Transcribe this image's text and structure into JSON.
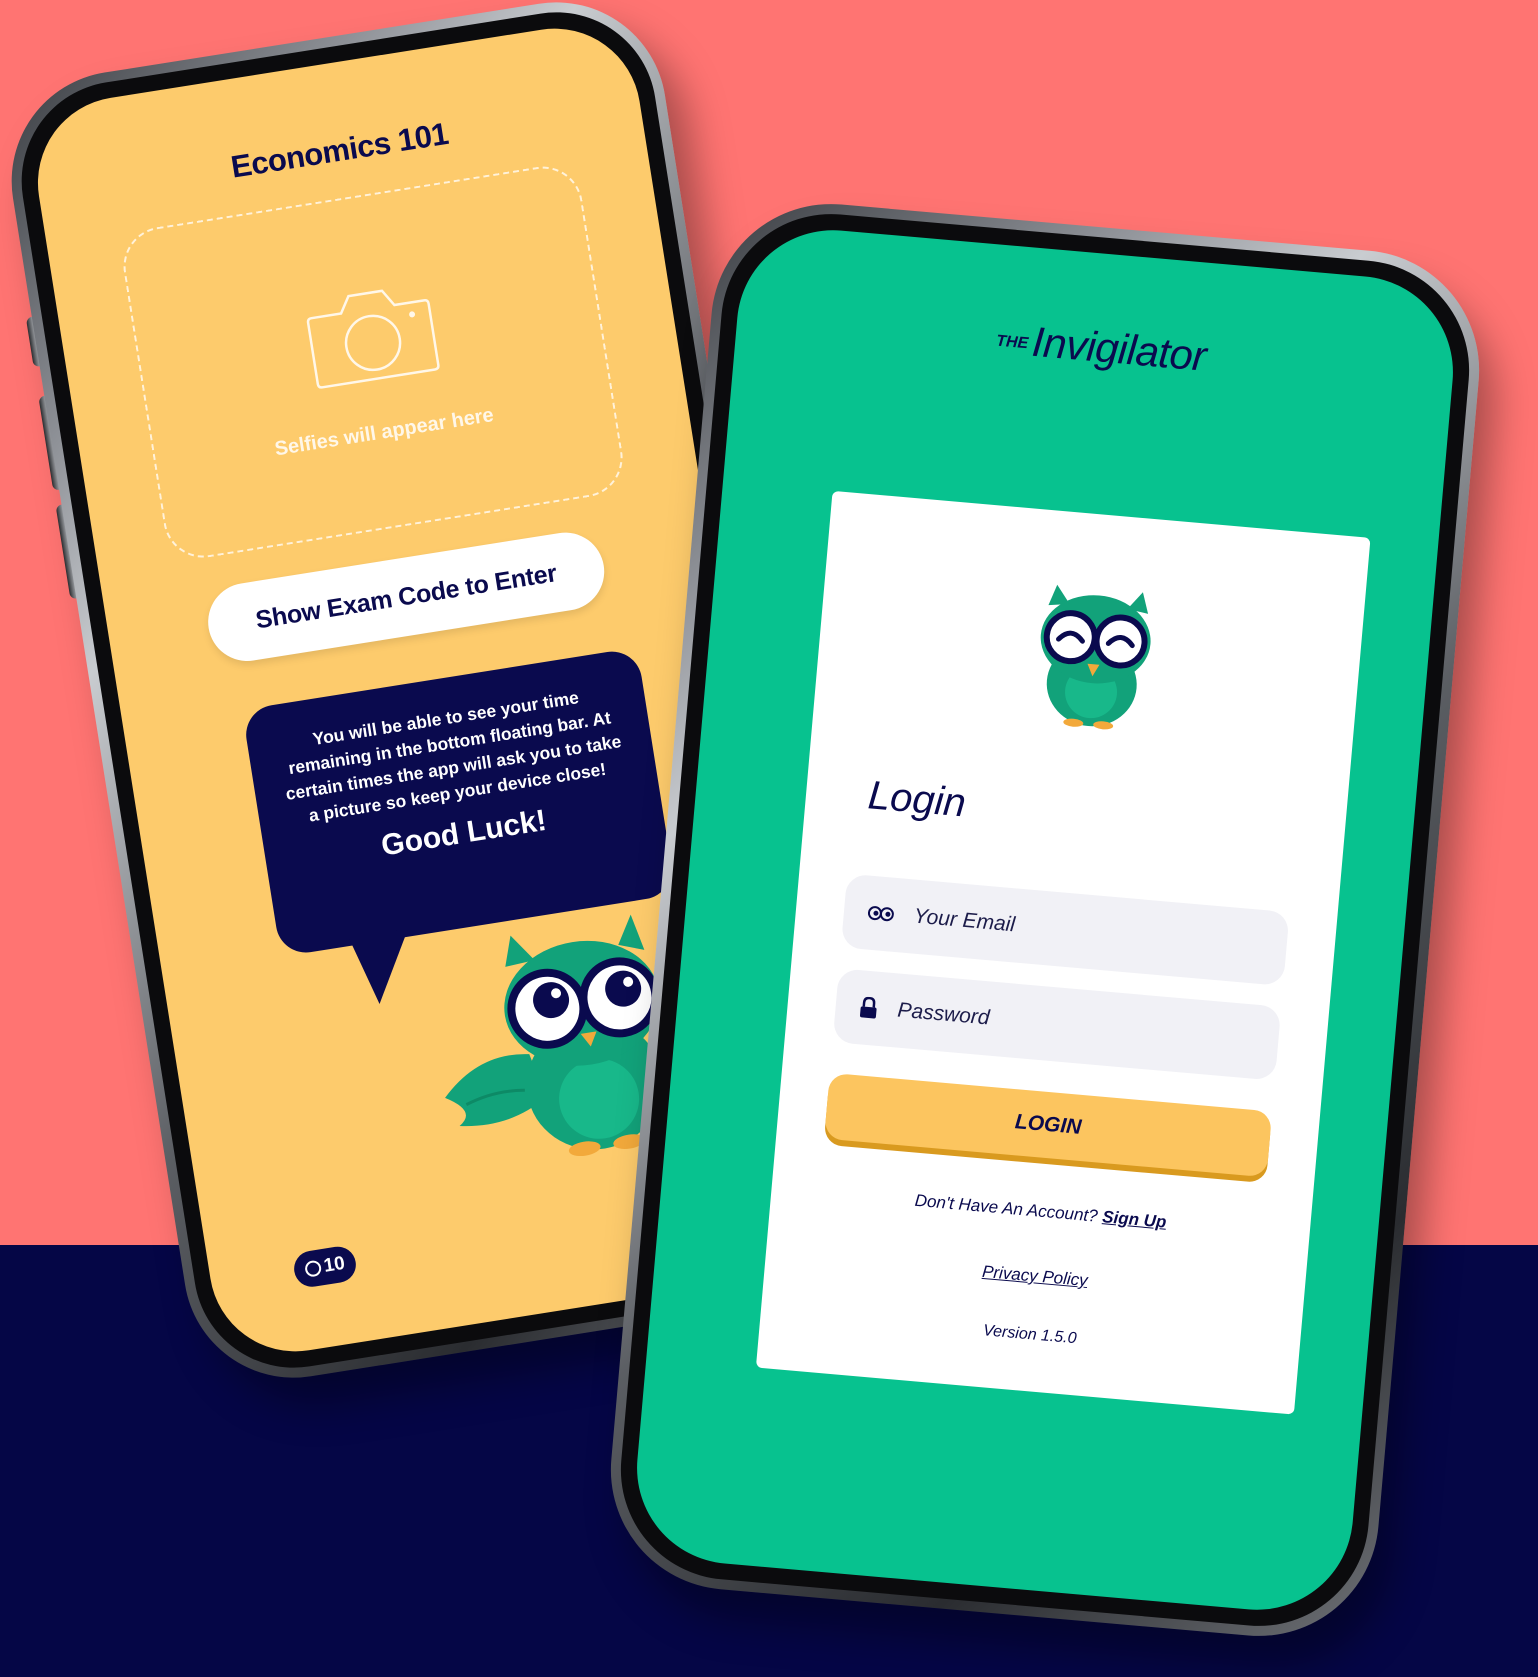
{
  "colors": {
    "background_top": "#ff7472",
    "background_bottom": "#050646",
    "exam_screen": "#fdcb6c",
    "navy": "#0a0a4e",
    "login_screen": "#07c28f",
    "white": "#ffffff",
    "field_bg": "#f1f1f6",
    "login_button": "#fcc55f",
    "owl_green": "#12a27a"
  },
  "exam_screen": {
    "title": "Economics 101",
    "selfie_placeholder": {
      "icon": "camera-icon",
      "text": "Selfies will appear here"
    },
    "exam_code_button": "Show Exam Code to Enter",
    "message": {
      "text": "You will be able to see your time remaining in the bottom floating bar. At certain times the app will ask you to take a picture so keep your device close!",
      "sign_off": "Good Luck!"
    },
    "timer": {
      "icon": "clock-icon",
      "value": "10"
    }
  },
  "login_screen": {
    "brand": {
      "prefix": "THE",
      "name": "Invigilator"
    },
    "title": "Login",
    "email_field": {
      "icon": "eyes-icon",
      "placeholder": "Your Email"
    },
    "password_field": {
      "icon": "lock-icon",
      "placeholder": "Password"
    },
    "login_button": "LOGIN",
    "signup_prompt": "Don't Have An Account?",
    "signup_link": "Sign Up",
    "privacy_link": "Privacy Policy",
    "version": "Version 1.5.0"
  }
}
